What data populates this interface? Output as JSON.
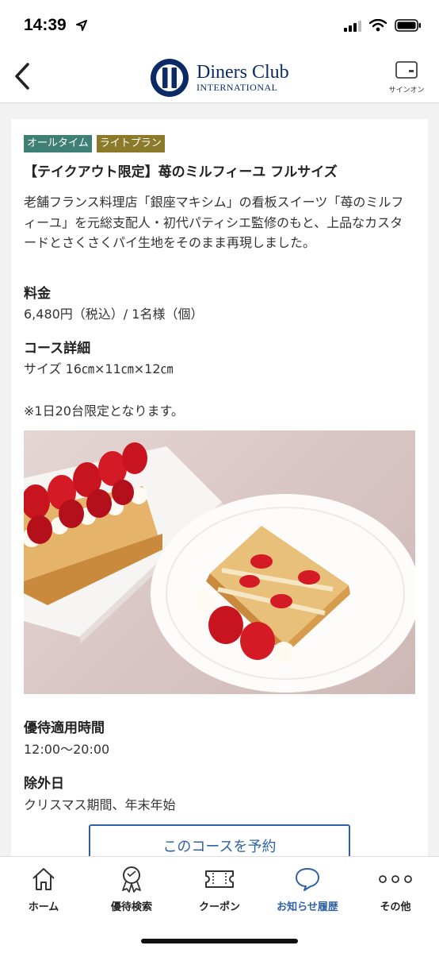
{
  "status": {
    "time": "14:39"
  },
  "header": {
    "logo_line1": "Diners Club",
    "logo_line2": "INTERNATIONAL",
    "signon_label": "サインオン"
  },
  "detail": {
    "tags": [
      "オールタイム",
      "ライトプラン"
    ],
    "title": "【テイクアウト限定】苺のミルフィーユ フルサイズ",
    "description": "老舗フランス料理店「銀座マキシム」の看板スイーツ「苺のミルフィーユ」を元総支配人・初代パティシエ監修のもと、上品なカスタードとさくさくパイ生地をそのまま再現しました。",
    "price_label": "料金",
    "price_value": "6,480円（税込）/ 1名様（個）",
    "course_label": "コース詳細",
    "course_value": "サイズ 16㎝×11㎝×12㎝",
    "note": "※1日20台限定となります。",
    "time_label": "優待適用時間",
    "time_value": "12:00〜20:00",
    "exclude_label": "除外日",
    "exclude_value": "クリスマス期間、年末年始",
    "reserve_label": "このコースを予約"
  },
  "tabs": [
    {
      "label": "ホーム",
      "icon": "home-icon"
    },
    {
      "label": "優待検索",
      "icon": "award-search-icon"
    },
    {
      "label": "クーポン",
      "icon": "coupon-icon"
    },
    {
      "label": "お知らせ履歴",
      "icon": "notification-bubble-icon"
    },
    {
      "label": "その他",
      "icon": "more-dots-icon"
    }
  ],
  "colors": {
    "accent": "#2d62a8",
    "tag_alltime": "#3e8073",
    "tag_light": "#8a7a2a",
    "brand_navy": "#0b2a66"
  }
}
